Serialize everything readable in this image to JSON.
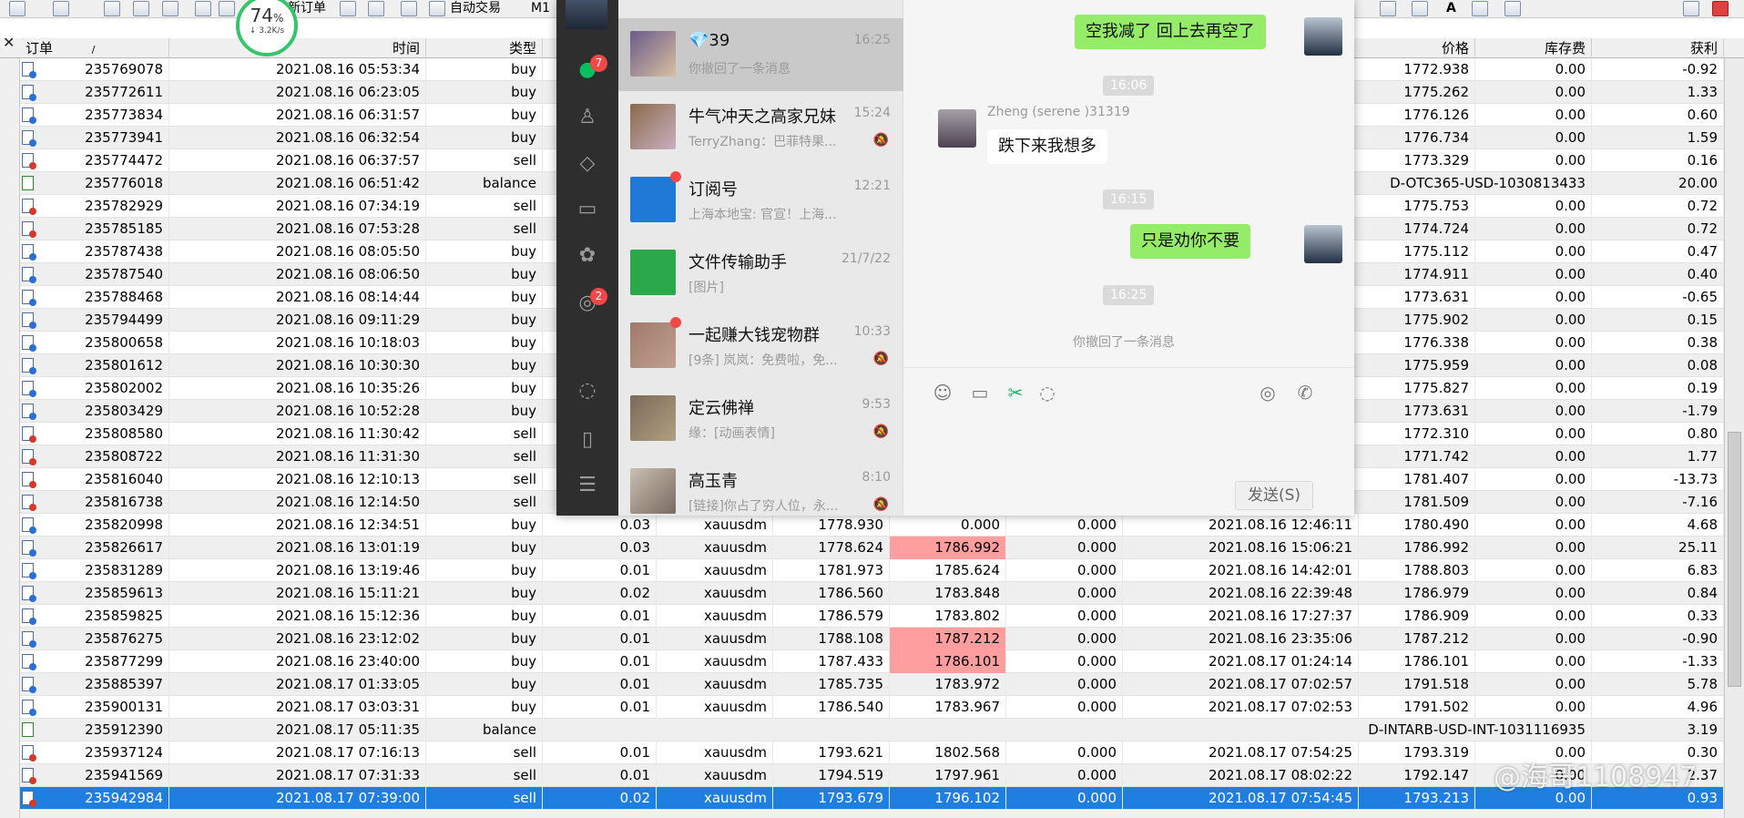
{
  "toolbar": {
    "new_order": "新订单",
    "auto_trading": "自动交易",
    "timeframe": "M1",
    "speed_percent": "74",
    "speed_unit": "%",
    "speed_rate": "↓ 3.2K/s"
  },
  "headers": {
    "order": "订单",
    "sort_mark": "/",
    "time": "时间",
    "type": "类型",
    "price": "价格",
    "swap": "库存费",
    "profit": "获利"
  },
  "rows": [
    {
      "o": "235769078",
      "t": "2021.08.16 05:53:34",
      "ty": "buy",
      "p": "1772.938",
      "sw": "0.00",
      "pr": "-0.92"
    },
    {
      "o": "235772611",
      "t": "2021.08.16 06:23:05",
      "ty": "buy",
      "p": "1775.262",
      "sw": "0.00",
      "pr": "1.33"
    },
    {
      "o": "235773834",
      "t": "2021.08.16 06:31:57",
      "ty": "buy",
      "p": "1776.126",
      "sw": "0.00",
      "pr": "0.60"
    },
    {
      "o": "235773941",
      "t": "2021.08.16 06:32:54",
      "ty": "buy",
      "p": "1776.734",
      "sw": "0.00",
      "pr": "1.59"
    },
    {
      "o": "235774472",
      "t": "2021.08.16 06:37:57",
      "ty": "sell",
      "p": "1773.329",
      "sw": "0.00",
      "pr": "0.16"
    },
    {
      "o": "235776018",
      "t": "2021.08.16 06:51:42",
      "ty": "balance",
      "comment": "D-OTC365-USD-1030813433",
      "pr": "20.00"
    },
    {
      "o": "235782929",
      "t": "2021.08.16 07:34:19",
      "ty": "sell",
      "p": "1775.753",
      "sw": "0.00",
      "pr": "0.72"
    },
    {
      "o": "235785185",
      "t": "2021.08.16 07:53:28",
      "ty": "sell",
      "p": "1774.724",
      "sw": "0.00",
      "pr": "0.72"
    },
    {
      "o": "235787438",
      "t": "2021.08.16 08:05:50",
      "ty": "buy",
      "p": "1775.112",
      "sw": "0.00",
      "pr": "0.47"
    },
    {
      "o": "235787540",
      "t": "2021.08.16 08:06:50",
      "ty": "buy",
      "p": "1774.911",
      "sw": "0.00",
      "pr": "0.40"
    },
    {
      "o": "235788468",
      "t": "2021.08.16 08:14:44",
      "ty": "buy",
      "p": "1773.631",
      "sw": "0.00",
      "pr": "-0.65"
    },
    {
      "o": "235794499",
      "t": "2021.08.16 09:11:29",
      "ty": "buy",
      "p": "1775.902",
      "sw": "0.00",
      "pr": "0.15"
    },
    {
      "o": "235800658",
      "t": "2021.08.16 10:18:03",
      "ty": "buy",
      "p": "1776.338",
      "sw": "0.00",
      "pr": "0.38"
    },
    {
      "o": "235801612",
      "t": "2021.08.16 10:30:30",
      "ty": "buy",
      "p": "1775.959",
      "sw": "0.00",
      "pr": "0.08"
    },
    {
      "o": "235802002",
      "t": "2021.08.16 10:35:26",
      "ty": "buy",
      "p": "1775.827",
      "sw": "0.00",
      "pr": "0.19"
    },
    {
      "o": "235803429",
      "t": "2021.08.16 10:52:28",
      "ty": "buy",
      "p": "1773.631",
      "sw": "0.00",
      "pr": "-1.79"
    },
    {
      "o": "235808580",
      "t": "2021.08.16 11:30:42",
      "ty": "sell",
      "p": "1772.310",
      "sw": "0.00",
      "pr": "0.80"
    },
    {
      "o": "235808722",
      "t": "2021.08.16 11:31:30",
      "ty": "sell",
      "p": "1771.742",
      "sw": "0.00",
      "pr": "1.77"
    },
    {
      "o": "235816040",
      "t": "2021.08.16 12:10:13",
      "ty": "sell",
      "p": "1781.407",
      "sw": "0.00",
      "pr": "-13.73"
    },
    {
      "o": "235816738",
      "t": "2021.08.16 12:14:50",
      "ty": "sell",
      "p": "1781.509",
      "sw": "0.00",
      "pr": "-7.16"
    },
    {
      "o": "235820998",
      "t": "2021.08.16 12:34:51",
      "ty": "buy",
      "sz": "0.03",
      "sy": "xauusdm",
      "op": "1778.930",
      "sl": "0.000",
      "tp": "0.000",
      "ct": "2021.08.16 12:46:11",
      "p": "1780.490",
      "sw": "0.00",
      "pr": "4.68"
    },
    {
      "o": "235826617",
      "t": "2021.08.16 13:01:19",
      "ty": "buy",
      "sz": "0.03",
      "sy": "xauusdm",
      "op": "1778.624",
      "sl": "1786.992",
      "sl_hl": true,
      "tp": "0.000",
      "ct": "2021.08.16 15:06:21",
      "p": "1786.992",
      "sw": "0.00",
      "pr": "25.11"
    },
    {
      "o": "235831289",
      "t": "2021.08.16 13:19:46",
      "ty": "buy",
      "sz": "0.01",
      "sy": "xauusdm",
      "op": "1781.973",
      "sl": "1785.624",
      "tp": "0.000",
      "ct": "2021.08.16 14:42:01",
      "p": "1788.803",
      "sw": "0.00",
      "pr": "6.83"
    },
    {
      "o": "235859613",
      "t": "2021.08.16 15:11:21",
      "ty": "buy",
      "sz": "0.02",
      "sy": "xauusdm",
      "op": "1786.560",
      "sl": "1783.848",
      "tp": "0.000",
      "ct": "2021.08.16 22:39:48",
      "p": "1786.979",
      "sw": "0.00",
      "pr": "0.84"
    },
    {
      "o": "235859825",
      "t": "2021.08.16 15:12:36",
      "ty": "buy",
      "sz": "0.01",
      "sy": "xauusdm",
      "op": "1786.579",
      "sl": "1783.802",
      "tp": "0.000",
      "ct": "2021.08.16 17:27:37",
      "p": "1786.909",
      "sw": "0.00",
      "pr": "0.33"
    },
    {
      "o": "235876275",
      "t": "2021.08.16 23:12:02",
      "ty": "buy",
      "sz": "0.01",
      "sy": "xauusdm",
      "op": "1788.108",
      "sl": "1787.212",
      "sl_hl": true,
      "tp": "0.000",
      "ct": "2021.08.16 23:35:06",
      "p": "1787.212",
      "sw": "0.00",
      "pr": "-0.90"
    },
    {
      "o": "235877299",
      "t": "2021.08.16 23:40:00",
      "ty": "buy",
      "sz": "0.01",
      "sy": "xauusdm",
      "op": "1787.433",
      "sl": "1786.101",
      "sl_hl": true,
      "tp": "0.000",
      "ct": "2021.08.17 01:24:14",
      "p": "1786.101",
      "sw": "0.00",
      "pr": "-1.33"
    },
    {
      "o": "235885397",
      "t": "2021.08.17 01:33:05",
      "ty": "buy",
      "sz": "0.01",
      "sy": "xauusdm",
      "op": "1785.735",
      "sl": "1783.972",
      "tp": "0.000",
      "ct": "2021.08.17 07:02:57",
      "p": "1791.518",
      "sw": "0.00",
      "pr": "5.78"
    },
    {
      "o": "235900131",
      "t": "2021.08.17 03:03:31",
      "ty": "buy",
      "sz": "0.01",
      "sy": "xauusdm",
      "op": "1786.540",
      "sl": "1783.967",
      "tp": "0.000",
      "ct": "2021.08.17 07:02:53",
      "p": "1791.502",
      "sw": "0.00",
      "pr": "4.96"
    },
    {
      "o": "235912390",
      "t": "2021.08.17 05:11:35",
      "ty": "balance",
      "comment": "D-INTARB-USD-INT-1031116935",
      "pr": "3.19"
    },
    {
      "o": "235937124",
      "t": "2021.08.17 07:16:13",
      "ty": "sell",
      "sz": "0.01",
      "sy": "xauusdm",
      "op": "1793.621",
      "sl": "1802.568",
      "tp": "0.000",
      "ct": "2021.08.17 07:54:25",
      "p": "1793.319",
      "sw": "0.00",
      "pr": "0.30"
    },
    {
      "o": "235941569",
      "t": "2021.08.17 07:31:33",
      "ty": "sell",
      "sz": "0.01",
      "sy": "xauusdm",
      "op": "1794.519",
      "sl": "1797.961",
      "tp": "0.000",
      "ct": "2021.08.17 08:02:22",
      "p": "1792.147",
      "sw": "0.00",
      "pr": "2.37"
    },
    {
      "o": "235942984",
      "t": "2021.08.17 07:39:00",
      "ty": "sell",
      "sz": "0.02",
      "sy": "xauusdm",
      "op": "1793.679",
      "sl": "1796.102",
      "tp": "0.000",
      "ct": "2021.08.17 07:54:45",
      "p": "1793.213",
      "sw": "0.00",
      "pr": "0.93",
      "selected": true
    }
  ],
  "wechat": {
    "nav_badges": {
      "chat": "7",
      "moments": "2"
    },
    "chats": [
      {
        "name": "💎39",
        "time": "16:25",
        "msg": "你撤回了一条消息",
        "active": true
      },
      {
        "name": "牛气冲天之高家兄妹",
        "time": "15:24",
        "msg": "TerryZhang：巴菲特果...",
        "muted": true
      },
      {
        "name": "订阅号",
        "time": "12:21",
        "msg": "上海本地宝: 官宣！上海...",
        "dot": true
      },
      {
        "name": "文件传输助手",
        "time": "21/7/22",
        "msg": "[图片]"
      },
      {
        "name": "一起赚大钱宠物群",
        "time": "10:33",
        "msg": "[9条] 岚岚：免费啦，免...",
        "muted": true,
        "dot": true
      },
      {
        "name": "定云佛禅",
        "time": "9:53",
        "msg": "缘：[动画表情]",
        "muted": true
      },
      {
        "name": "高玉青",
        "time": "8:10",
        "msg": "[链接]你占了穷人位，永...",
        "muted": true
      }
    ],
    "messages": {
      "m1": "空我减了 回上去再空了",
      "t1": "16:06",
      "sender": "Zheng (serene )31319",
      "m2": "跌下来我想多",
      "t2": "16:15",
      "m3": "只是劝你不要",
      "t3": "16:25",
      "recall": "你撤回了一条消息"
    },
    "send": "发送(S)"
  },
  "watermark": "@海哥1108947"
}
